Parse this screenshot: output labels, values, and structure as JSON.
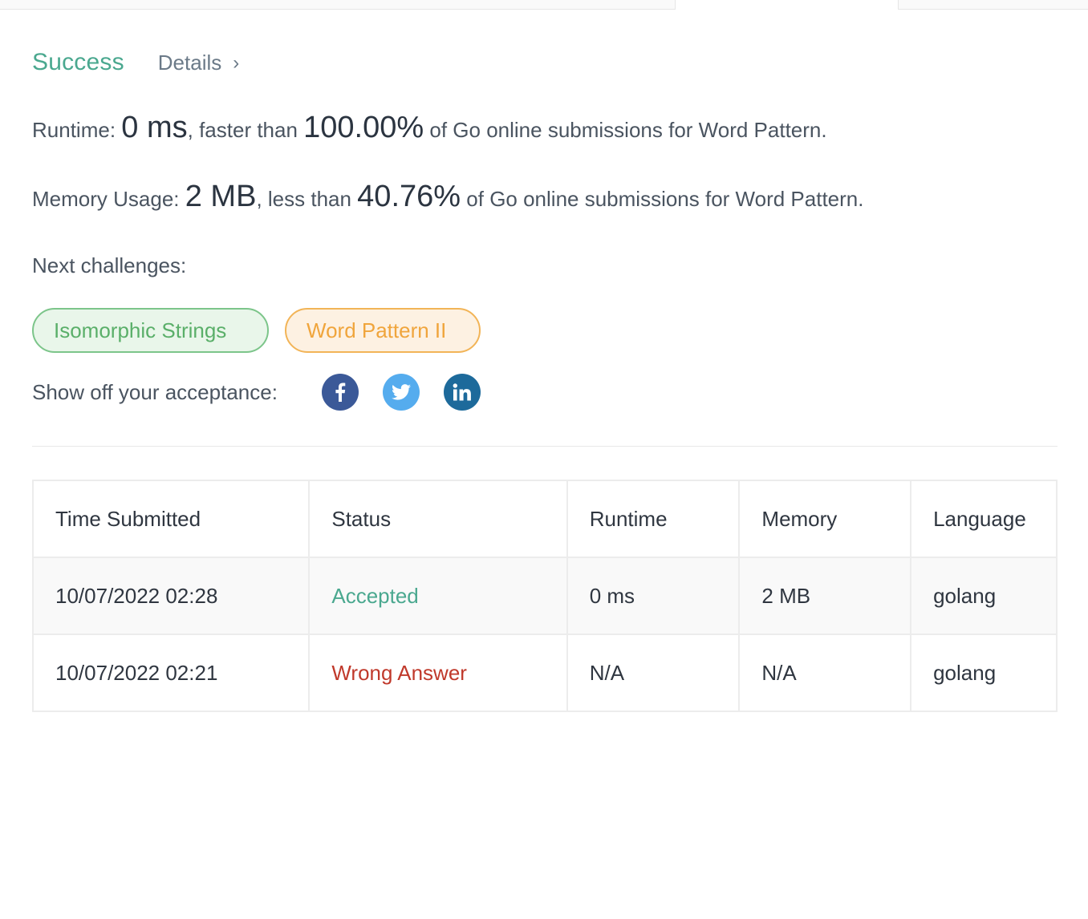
{
  "colors": {
    "success": "#4aa88f",
    "wrong": "#c0392b",
    "chip_green": "#5aaf69",
    "chip_orange": "#f0a53c",
    "facebook": "#3b5998",
    "twitter": "#55acee",
    "linkedin": "#1d6a9b"
  },
  "result": {
    "status": "Success",
    "details_label": "Details",
    "chevron": "›"
  },
  "runtime": {
    "label": "Runtime: ",
    "value": "0 ms",
    "comparison": ", faster than ",
    "percent": "100.00%",
    "suffix": " of Go online submissions for Word Pattern."
  },
  "memory": {
    "label": "Memory Usage: ",
    "value": "2 MB",
    "comparison": ", less than ",
    "percent": "40.76%",
    "suffix": " of Go online submissions for Word Pattern."
  },
  "next_challenges": {
    "label": "Next challenges:",
    "items": [
      {
        "label": "Isomorphic Strings",
        "difficulty_color": "green"
      },
      {
        "label": "Word Pattern II",
        "difficulty_color": "orange"
      }
    ]
  },
  "share": {
    "label": "Show off your acceptance:",
    "icons": [
      "facebook-icon",
      "twitter-icon",
      "linkedin-icon"
    ]
  },
  "table": {
    "headers": [
      "Time Submitted",
      "Status",
      "Runtime",
      "Memory",
      "Language"
    ],
    "rows": [
      {
        "time": "10/07/2022 02:28",
        "status": "Accepted",
        "runtime": "0 ms",
        "memory": "2 MB",
        "language": "golang"
      },
      {
        "time": "10/07/2022 02:21",
        "status": "Wrong Answer",
        "runtime": "N/A",
        "memory": "N/A",
        "language": "golang"
      }
    ]
  }
}
